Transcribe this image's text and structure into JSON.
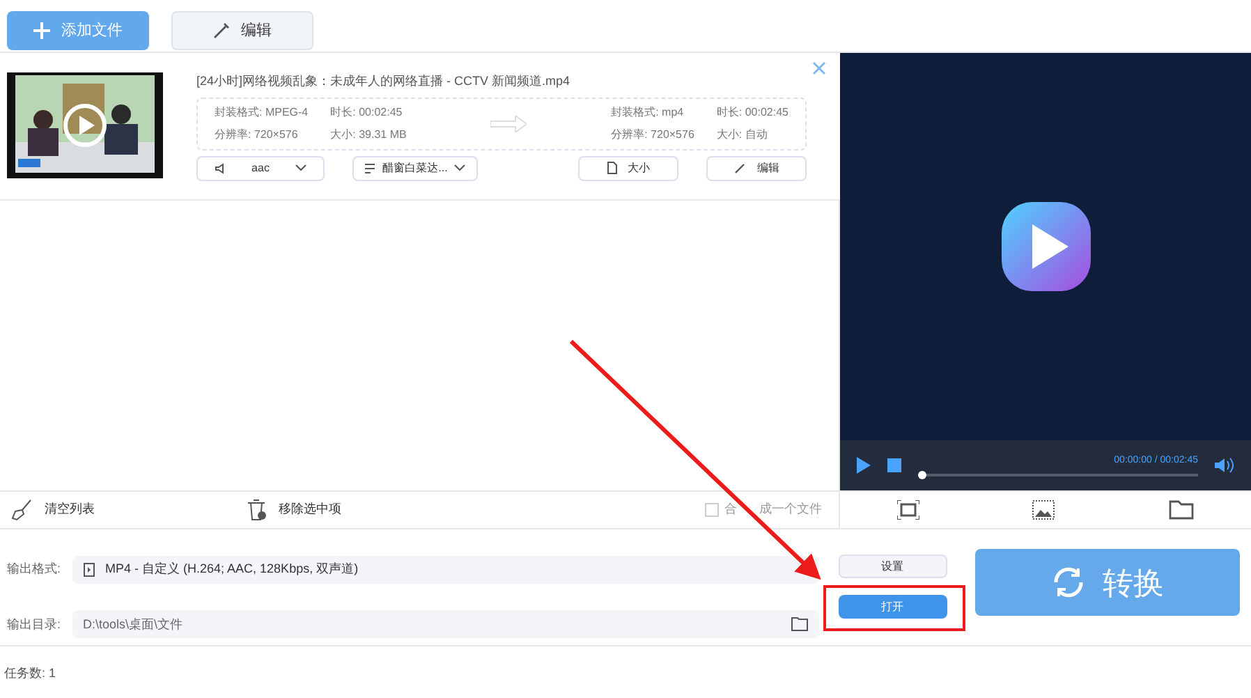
{
  "toolbar": {
    "buttons": [
      {
        "label": "添加文件",
        "kind": "primary"
      },
      {
        "label": "编辑",
        "kind": "secondary"
      }
    ]
  },
  "file": {
    "title": "[24小时]网络视频乱象：未成年人的网络直播  - CCTV 新闻频道.mp4",
    "source": [
      {
        "label": "封装格式:",
        "value": "MPEG-4"
      },
      {
        "label": "时长:",
        "value": "00:02:45"
      },
      {
        "label": "分辨率:",
        "value": "720×576"
      },
      {
        "label": "大小:",
        "value": "39.31 MB"
      }
    ],
    "target": [
      {
        "label": "封装格式:",
        "value": "mp4"
      },
      {
        "label": "时长:",
        "value": "00:02:45"
      },
      {
        "label": "分辨率:",
        "value": "720×576"
      },
      {
        "label": "大小:",
        "value": "自动"
      }
    ],
    "audio": "aac",
    "subtitle": "醋窗白菜达...",
    "size_button": "大小",
    "edit_button": "编辑"
  },
  "preview": {
    "time": "00:00:00 / 00:02:45",
    "level": 0
  },
  "list_tools": {
    "clear": "清空列表",
    "remove": "移除选中项",
    "merge": {
      "label_parts": [
        "合",
        "成一个文件"
      ],
      "checked": false
    }
  },
  "output": {
    "format_label": "输出格式:",
    "format": "MP4 - 自定义 (H.264; AAC, 128Kbps, 双声道)",
    "dir_label": "输出目录:",
    "dir": "D:\\tools\\桌面\\文件",
    "settings": "设置",
    "open": "打开",
    "convert": "转换"
  },
  "status": "任务数: 1"
}
